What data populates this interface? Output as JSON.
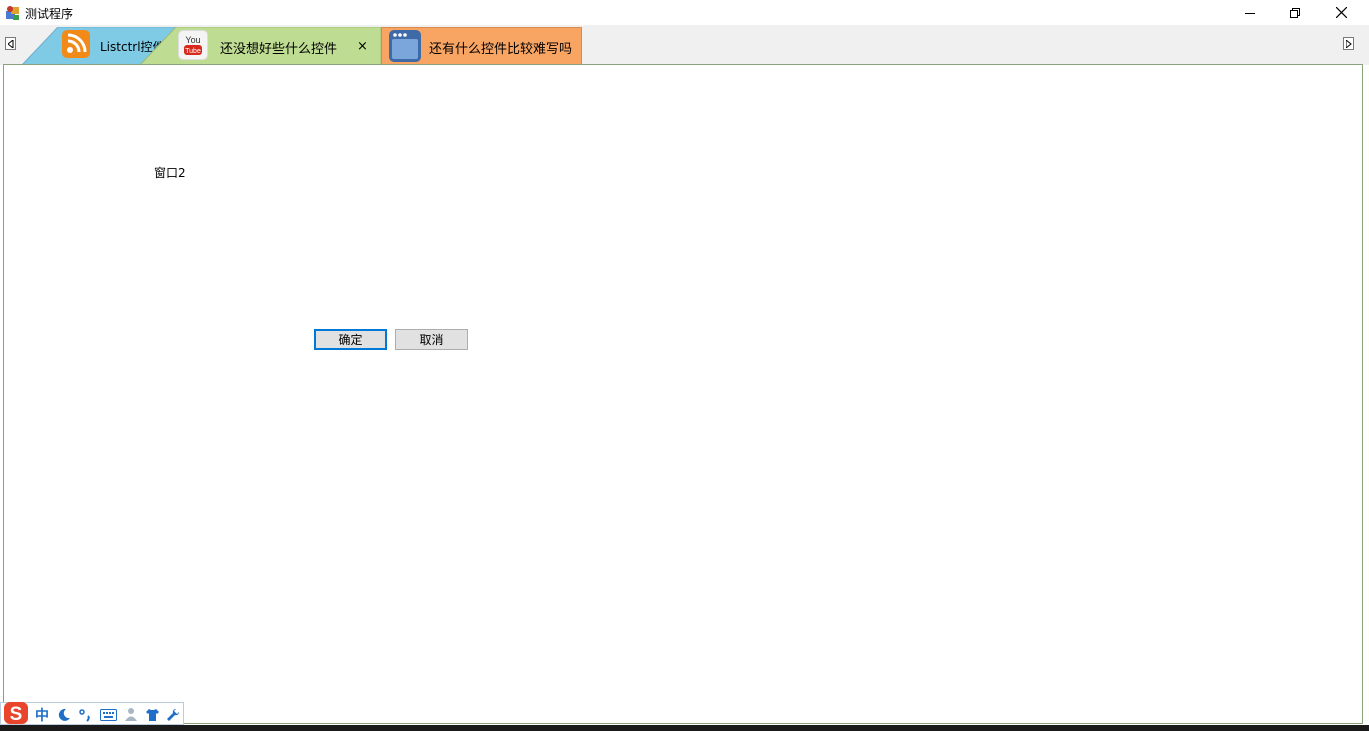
{
  "window": {
    "title": "测试程序",
    "controls": [
      "minimize-icon",
      "restore-icon",
      "close-icon"
    ]
  },
  "tabs": [
    {
      "label": "Listctrl控件",
      "icon": "rss-icon",
      "color": "#7fcbe6"
    },
    {
      "label": "还没想好些什么控件",
      "icon": "youtube-icon",
      "color": "#bfdc93",
      "close": "×"
    },
    {
      "label": "还有什么控件比较难写吗",
      "icon": "window-icon",
      "color": "#f8a564"
    }
  ],
  "content": {
    "window_label": "窗口2",
    "ok_label": "确定",
    "cancel_label": "取消"
  },
  "ime": {
    "logo": "S",
    "mode": "中",
    "icons": [
      "moon-icon",
      "punctuation-icon",
      "keyboard-icon",
      "user-icon",
      "shirt-icon",
      "wrench-icon"
    ]
  },
  "colors": {
    "accent": "#0078d7",
    "frame_border": "#8aa37a",
    "ime_brand": "#e8452c",
    "ime_icon": "#1e6fc8"
  }
}
